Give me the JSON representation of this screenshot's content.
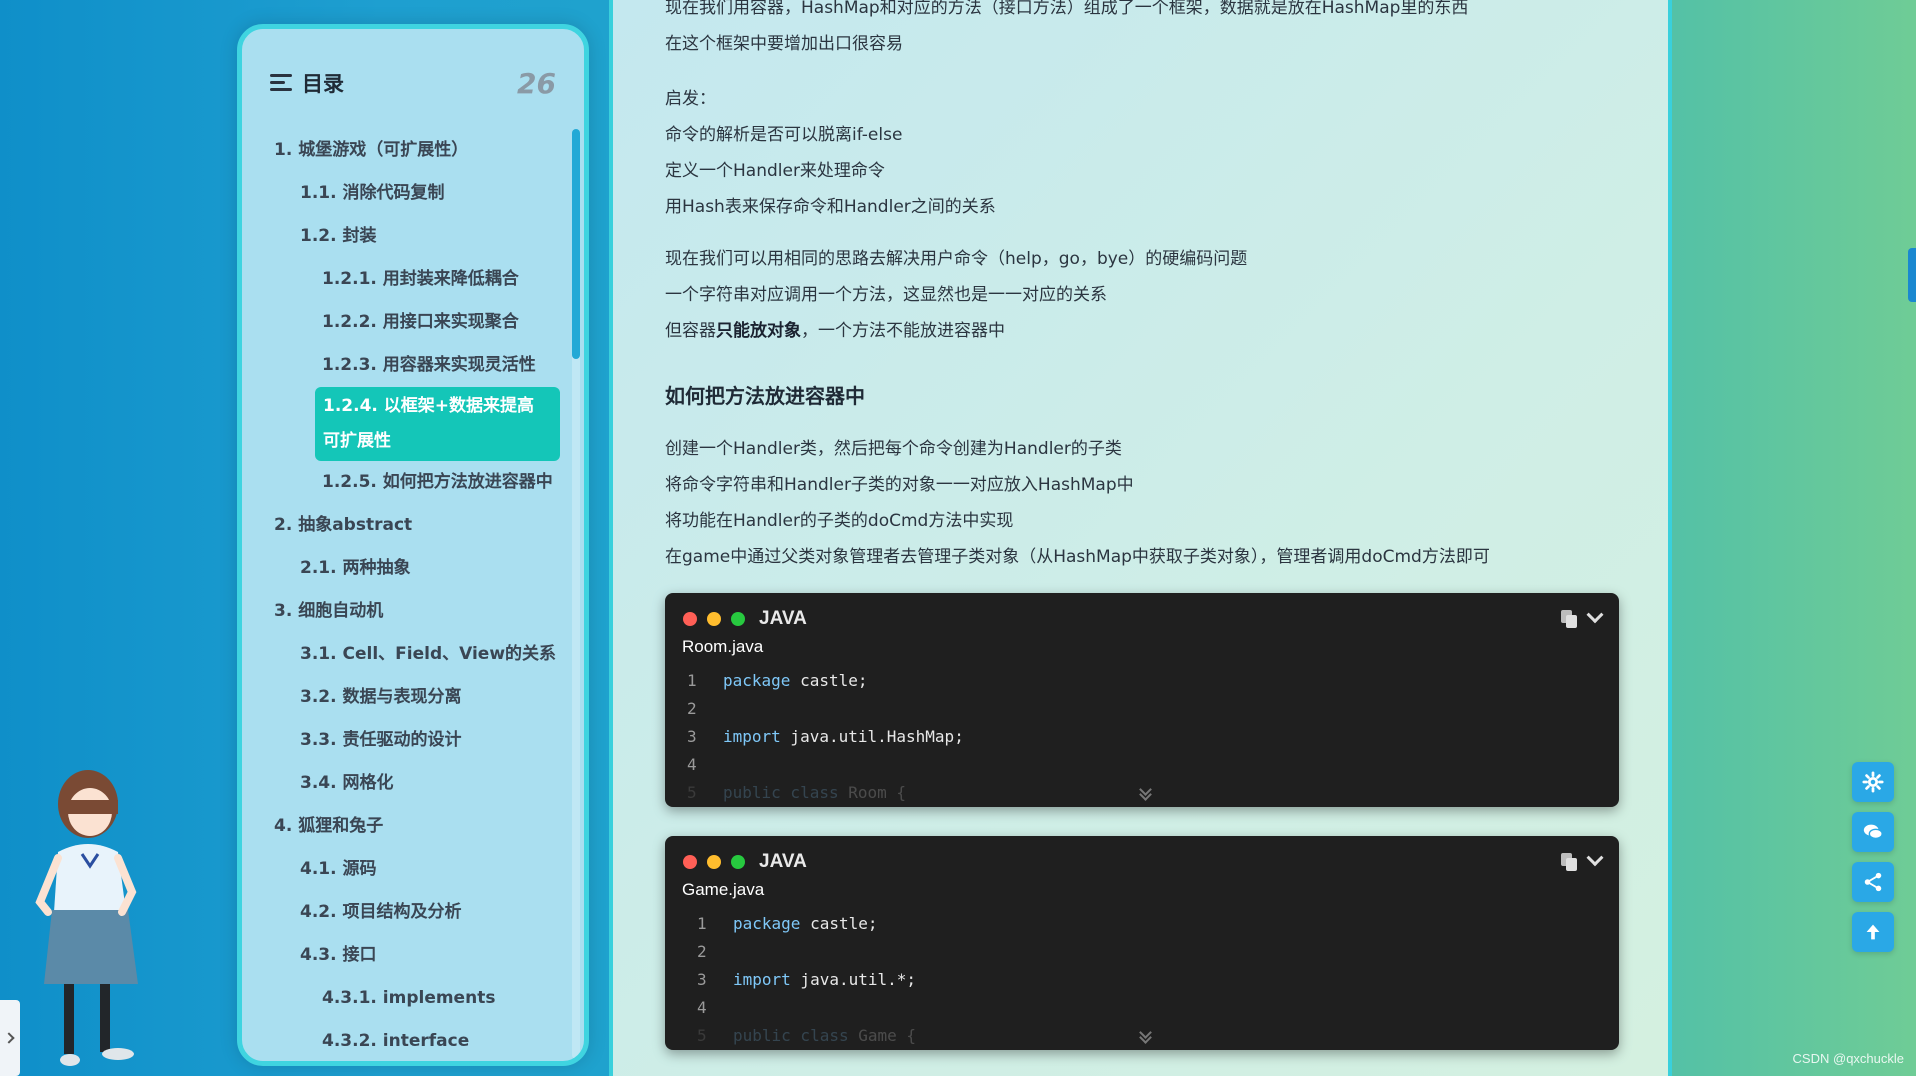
{
  "toc": {
    "title": "目录",
    "count": "26",
    "items": [
      {
        "label": "1. 城堡游戏（可扩展性）",
        "level": 1
      },
      {
        "label": "1.1. 消除代码复制",
        "level": 2
      },
      {
        "label": "1.2. 封装",
        "level": 2
      },
      {
        "label": "1.2.1. 用封装来降低耦合",
        "level": 3
      },
      {
        "label": "1.2.2. 用接口来实现聚合",
        "level": 3
      },
      {
        "label": "1.2.3. 用容器来实现灵活性",
        "level": 3
      },
      {
        "label": "1.2.4. 以框架+数据来提高可扩展性",
        "level": 3,
        "active": true
      },
      {
        "label": "1.2.5. 如何把方法放进容器中",
        "level": 3
      },
      {
        "label": "2. 抽象abstract",
        "level": 1
      },
      {
        "label": "2.1. 两种抽象",
        "level": 2
      },
      {
        "label": "3. 细胞自动机",
        "level": 1
      },
      {
        "label": "3.1. Cell、Field、View的关系",
        "level": 2
      },
      {
        "label": "3.2. 数据与表现分离",
        "level": 2
      },
      {
        "label": "3.3. 责任驱动的设计",
        "level": 2
      },
      {
        "label": "3.4. 网格化",
        "level": 2
      },
      {
        "label": "4. 狐狸和兔子",
        "level": 1
      },
      {
        "label": "4.1. 源码",
        "level": 2
      },
      {
        "label": "4.2. 项目结构及分析",
        "level": 2
      },
      {
        "label": "4.3. 接口",
        "level": 2
      },
      {
        "label": "4.3.1. implements",
        "level": 3
      },
      {
        "label": "4.3.2. interface",
        "level": 3
      }
    ]
  },
  "article": {
    "p1a": "现在我们用容器，HashMap和对应的方法（接口方法）组成了一个框架，数据就是放在HashMap里的东西",
    "p1b": "在这个框架中要增加出口很容易",
    "p2a": "启发：",
    "p2b": "命令的解析是否可以脱离if-else",
    "p2c": "定义一个Handler来处理命令",
    "p2d": "用Hash表来保存命令和Handler之间的关系",
    "p3a": "现在我们可以用相同的思路去解决用户命令（help，go，bye）的硬编码问题",
    "p3b": "一个字符串对应调用一个方法，这显然也是一一对应的关系",
    "p3c_pre": "但容器",
    "p3c_bold": "只能放对象",
    "p3c_post": "，一个方法不能放进容器中",
    "heading": "如何把方法放进容器中",
    "p4a": "创建一个Handler类，然后把每个命令创建为Handler的子类",
    "p4b": "将命令字符串和Handler子类的对象一一对应放入HashMap中",
    "p4c": "将功能在Handler的子类的doCmd方法中实现",
    "p4d": "在game中通过父类对象管理者去管理子类对象（从HashMap中获取子类对象），管理者调用doCmd方法即可"
  },
  "code1": {
    "lang": "JAVA",
    "filename": "Room.java",
    "lines": [
      {
        "no": "1",
        "kw": "package",
        "rest": " castle;"
      },
      {
        "no": "2",
        "kw": "",
        "rest": ""
      },
      {
        "no": "3",
        "kw": "import",
        "rest": " java.util.HashMap;"
      },
      {
        "no": "4",
        "kw": "",
        "rest": ""
      },
      {
        "no": "5",
        "kw": "public class",
        "rest": " Room {"
      }
    ]
  },
  "code2": {
    "lang": "JAVA",
    "filename": "Game.java",
    "lines": [
      {
        "no": "1",
        "kw": "package",
        "rest": " castle;"
      },
      {
        "no": "2",
        "kw": "",
        "rest": ""
      },
      {
        "no": "3",
        "kw": "import",
        "rest": " java.util.*;"
      },
      {
        "no": "4",
        "kw": "",
        "rest": ""
      },
      {
        "no": "5",
        "kw": "public class",
        "rest": " Game {"
      }
    ]
  },
  "float_buttons": [
    "gear-icon",
    "chat-icon",
    "share-icon",
    "arrow-up-icon"
  ],
  "watermark": "CSDN @qxchuckle",
  "colors": {
    "accent": "#14c6b8",
    "border": "#3fd4e0",
    "button": "#2aa8e6"
  }
}
